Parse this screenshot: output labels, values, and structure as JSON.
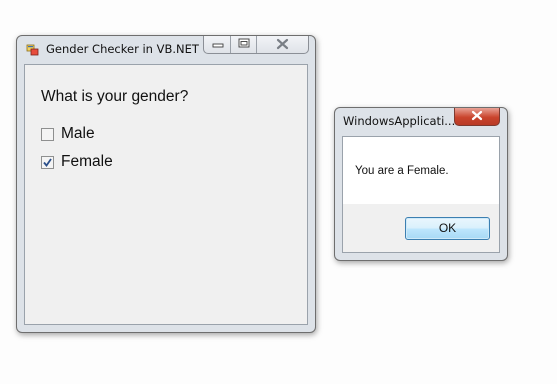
{
  "main_window": {
    "title": "Gender Checker in VB.NET",
    "question": "What is your gender?",
    "options": [
      {
        "label": "Male",
        "checked": false
      },
      {
        "label": "Female",
        "checked": true
      }
    ],
    "icons": {
      "app": "form-icon",
      "minimize": "minimize-icon",
      "maximize": "maximize-icon",
      "close": "close-icon"
    }
  },
  "message_box": {
    "title": "WindowsApplicati...",
    "message": "You are a Female.",
    "ok_label": "OK"
  },
  "colors": {
    "frame": "#dde2e8",
    "client": "#f0f0f0",
    "close_button": "#c9442c",
    "ok_border": "#3c7fb1"
  }
}
